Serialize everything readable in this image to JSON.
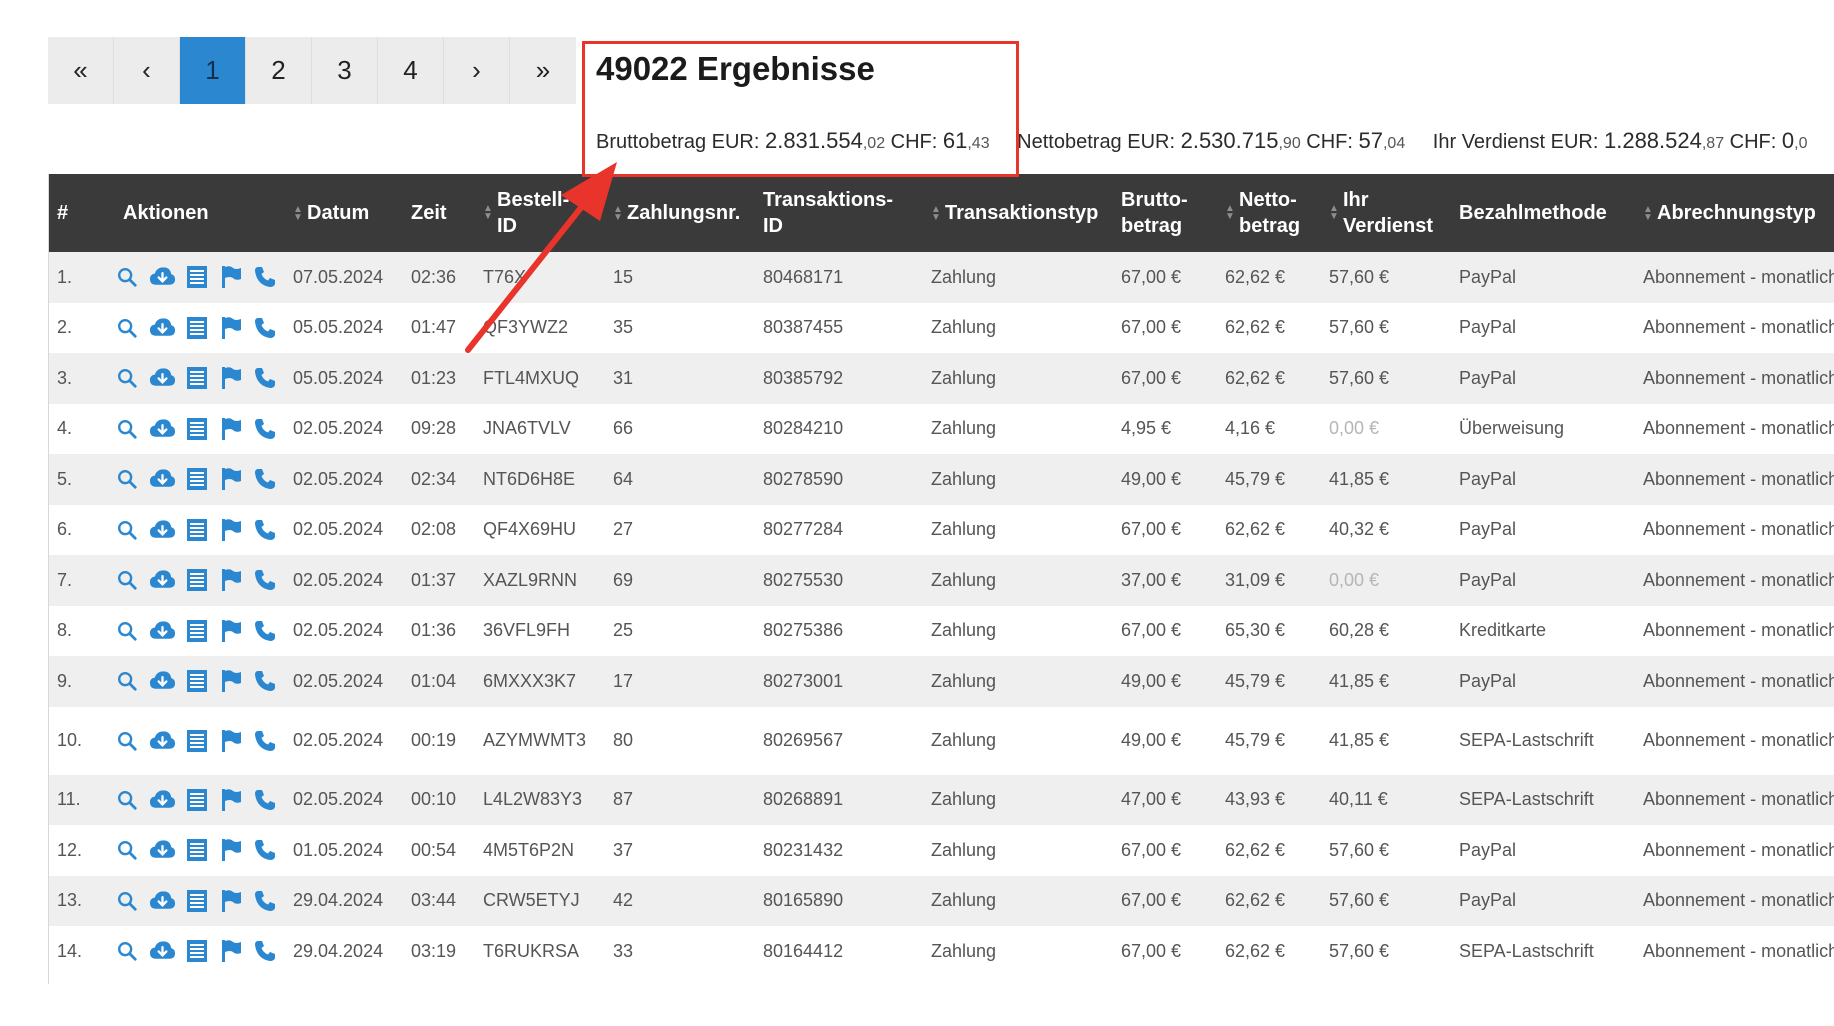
{
  "pagination": [
    "«",
    "‹",
    "1",
    "2",
    "3",
    "4",
    "›",
    "»"
  ],
  "pagination_active": "1",
  "results_title": "49022 Ergebnisse",
  "totals": [
    {
      "label": "Bruttobetrag EUR: ",
      "eur_main": "2.831.554",
      "eur_cents": ",02",
      "chf_label": " CHF: ",
      "chf_main": "61",
      "chf_cents": ",43"
    },
    {
      "label": "Nettobetrag EUR: ",
      "eur_main": "2.530.715",
      "eur_cents": ",90",
      "chf_label": " CHF: ",
      "chf_main": "57",
      "chf_cents": ",04"
    },
    {
      "label": "Ihr Verdienst EUR: ",
      "eur_main": "1.288.524",
      "eur_cents": ",87",
      "chf_label": " CHF: ",
      "chf_main": "0",
      "chf_cents": ",0"
    }
  ],
  "columns": [
    "#",
    "Aktionen",
    "Datum",
    "Zeit",
    "Bestell-ID",
    "Zahlungsnr.",
    "Transaktions-ID",
    "Transaktionstyp",
    "Brutto-betrag",
    "Netto-betrag",
    "Ihr Verdienst",
    "Bezahlmethode",
    "Abrechnungstyp"
  ],
  "column_headers": {
    "num": "#",
    "actions": "Aktionen",
    "date": "Datum",
    "time": "Zeit",
    "order_l1": "Bestell-",
    "order_l2": "ID",
    "payno": "Zahlungsnr.",
    "tx_l1": "Transaktions-",
    "tx_l2": "ID",
    "txtype": "Transaktionstyp",
    "gross_l1": "Brutto-",
    "gross_l2": "betrag",
    "net_l1": "Netto-",
    "net_l2": "betrag",
    "earn_l1": "Ihr",
    "earn_l2": "Verdienst",
    "method": "Bezahlmethode",
    "billing": "Abrechnungstyp"
  },
  "action_icons": [
    "search-icon",
    "cloud-download-icon",
    "document-icon",
    "flag-icon",
    "phone-icon"
  ],
  "accent_color": "#2a87d0",
  "highlight_color": "#e8342a",
  "rows": [
    {
      "num": "1.",
      "date": "07.05.2024",
      "time": "02:36",
      "order": "T76X",
      "payno": "15",
      "txid": "80468171",
      "type": "Zahlung",
      "gross": "67,00 €",
      "net": "62,62 €",
      "earn": "57,60 €",
      "method": "PayPal",
      "billing": "Abonnement - monatlich"
    },
    {
      "num": "2.",
      "date": "05.05.2024",
      "time": "01:47",
      "order": "QF3YWZ2",
      "payno": "35",
      "txid": "80387455",
      "type": "Zahlung",
      "gross": "67,00 €",
      "net": "62,62 €",
      "earn": "57,60 €",
      "method": "PayPal",
      "billing": "Abonnement - monatlich"
    },
    {
      "num": "3.",
      "date": "05.05.2024",
      "time": "01:23",
      "order": "FTL4MXUQ",
      "payno": "31",
      "txid": "80385792",
      "type": "Zahlung",
      "gross": "67,00 €",
      "net": "62,62 €",
      "earn": "57,60 €",
      "method": "PayPal",
      "billing": "Abonnement - monatlich"
    },
    {
      "num": "4.",
      "date": "02.05.2024",
      "time": "09:28",
      "order": "JNA6TVLV",
      "payno": "66",
      "txid": "80284210",
      "type": "Zahlung",
      "gross": "4,95 €",
      "net": "4,16 €",
      "earn": "0,00 €",
      "method": "Überweisung",
      "billing": "Abonnement - monatlich",
      "earn_muted": true
    },
    {
      "num": "5.",
      "date": "02.05.2024",
      "time": "02:34",
      "order": "NT6D6H8E",
      "payno": "64",
      "txid": "80278590",
      "type": "Zahlung",
      "gross": "49,00 €",
      "net": "45,79 €",
      "earn": "41,85 €",
      "method": "PayPal",
      "billing": "Abonnement - monatlich"
    },
    {
      "num": "6.",
      "date": "02.05.2024",
      "time": "02:08",
      "order": "QF4X69HU",
      "payno": "27",
      "txid": "80277284",
      "type": "Zahlung",
      "gross": "67,00 €",
      "net": "62,62 €",
      "earn": "40,32 €",
      "method": "PayPal",
      "billing": "Abonnement - monatlich"
    },
    {
      "num": "7.",
      "date": "02.05.2024",
      "time": "01:37",
      "order": "XAZL9RNN",
      "payno": "69",
      "txid": "80275530",
      "type": "Zahlung",
      "gross": "37,00 €",
      "net": "31,09 €",
      "earn": "0,00 €",
      "method": "PayPal",
      "billing": "Abonnement - monatlich",
      "earn_muted": true
    },
    {
      "num": "8.",
      "date": "02.05.2024",
      "time": "01:36",
      "order": "36VFL9FH",
      "payno": "25",
      "txid": "80275386",
      "type": "Zahlung",
      "gross": "67,00 €",
      "net": "65,30 €",
      "earn": "60,28 €",
      "method": "Kreditkarte",
      "billing": "Abonnement - monatlich"
    },
    {
      "num": "9.",
      "date": "02.05.2024",
      "time": "01:04",
      "order": "6MXXX3K7",
      "payno": "17",
      "txid": "80273001",
      "type": "Zahlung",
      "gross": "49,00 €",
      "net": "45,79 €",
      "earn": "41,85 €",
      "method": "PayPal",
      "billing": "Abonnement - monatlich"
    },
    {
      "num": "10.",
      "date": "02.05.2024",
      "time": "00:19",
      "order": "AZYMWMT3",
      "payno": "80",
      "txid": "80269567",
      "type": "Zahlung",
      "gross": "49,00 €",
      "net": "45,79 €",
      "earn": "41,85 €",
      "method": "SEPA-Lastschrift",
      "billing": "Abonnement - monatlich",
      "tall": true
    },
    {
      "num": "11.",
      "date": "02.05.2024",
      "time": "00:10",
      "order": "L4L2W83Y3",
      "payno": "87",
      "txid": "80268891",
      "type": "Zahlung",
      "gross": "47,00 €",
      "net": "43,93 €",
      "earn": "40,11 €",
      "method": "SEPA-Lastschrift",
      "billing": "Abonnement - monatlich"
    },
    {
      "num": "12.",
      "date": "01.05.2024",
      "time": "00:54",
      "order": "4M5T6P2N",
      "payno": "37",
      "txid": "80231432",
      "type": "Zahlung",
      "gross": "67,00 €",
      "net": "62,62 €",
      "earn": "57,60 €",
      "method": "PayPal",
      "billing": "Abonnement - monatlich"
    },
    {
      "num": "13.",
      "date": "29.04.2024",
      "time": "03:44",
      "order": "CRW5ETYJ",
      "payno": "42",
      "txid": "80165890",
      "type": "Zahlung",
      "gross": "67,00 €",
      "net": "62,62 €",
      "earn": "57,60 €",
      "method": "PayPal",
      "billing": "Abonnement - monatlich"
    },
    {
      "num": "14.",
      "date": "29.04.2024",
      "time": "03:19",
      "order": "T6RUKRSA",
      "payno": "33",
      "txid": "80164412",
      "type": "Zahlung",
      "gross": "67,00 €",
      "net": "62,62 €",
      "earn": "57,60 €",
      "method": "SEPA-Lastschrift",
      "billing": "Abonnement - monatlich"
    }
  ]
}
